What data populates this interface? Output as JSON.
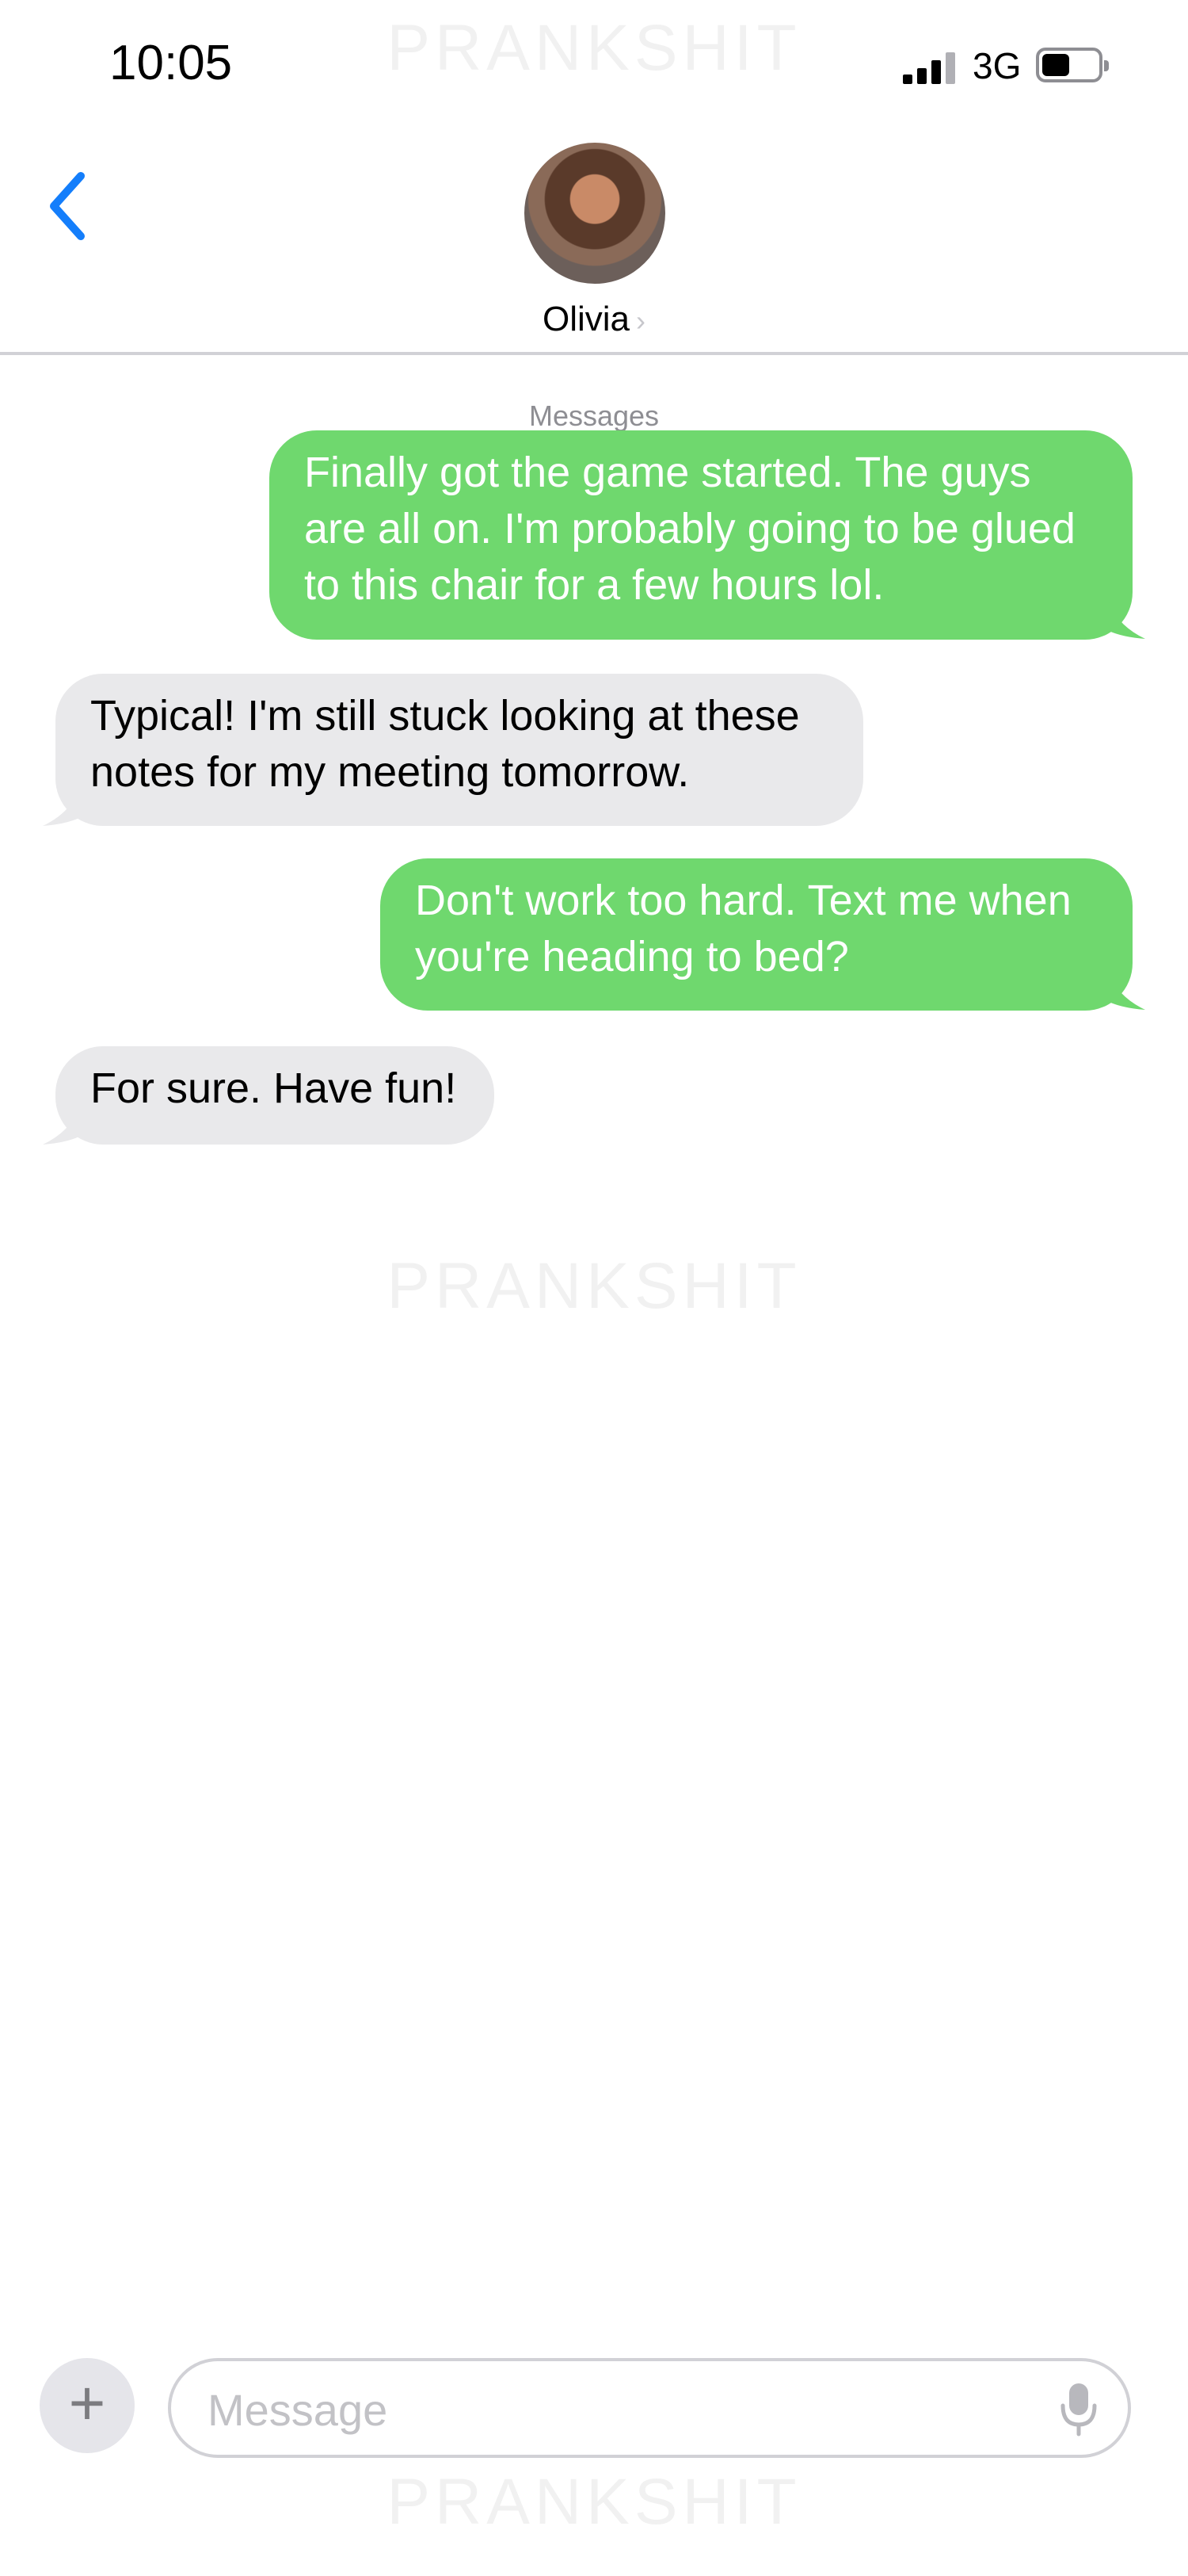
{
  "status_bar": {
    "time": "10:05",
    "network": "3G"
  },
  "watermarks": [
    "PRANKSHIT",
    "PRANKSHIT",
    "PRANKSHIT"
  ],
  "header": {
    "contact_name": "Olivia",
    "chevron": "›"
  },
  "service_label": "Messages",
  "messages": [
    {
      "direction": "sent",
      "lines": [
        "Finally got the game started. The guys",
        "are all on. I'm probably going to be glued",
        "to this chair for a few hours lol."
      ]
    },
    {
      "direction": "received",
      "lines": [
        "Typical! I'm still stuck looking at these",
        "notes for my meeting tomorrow."
      ]
    },
    {
      "direction": "sent",
      "lines": [
        "Don't work too hard. Text me when",
        "you're heading to bed?"
      ]
    },
    {
      "direction": "received",
      "lines": [
        "For sure. Have fun!"
      ]
    }
  ],
  "input_bar": {
    "plus": "+",
    "placeholder": "Message",
    "value": ""
  },
  "colors": {
    "sent_bubble": "#6fd86e",
    "received_bubble": "#e9e9eb",
    "accent": "#147efb"
  },
  "icons": {
    "back": "chevron-left-icon",
    "add": "plus-icon",
    "mic": "microphone-icon"
  }
}
